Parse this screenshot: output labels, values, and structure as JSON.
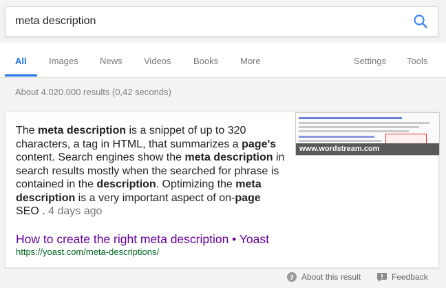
{
  "search": {
    "query": "meta description"
  },
  "tabs": [
    {
      "label": "All"
    },
    {
      "label": "Images"
    },
    {
      "label": "News"
    },
    {
      "label": "Videos"
    },
    {
      "label": "Books"
    },
    {
      "label": "More"
    }
  ],
  "tools": {
    "settings": "Settings",
    "tools": "Tools"
  },
  "stats": "About 4.020.000 results (0,42 seconds)",
  "snippet": {
    "parts": [
      "The ",
      "meta description",
      " is a snippet of up to 320 characters, a tag in HTML, that summarizes a ",
      "page's",
      " content. Search engines show the ",
      "meta description",
      " in search results mostly when the searched for phrase is contained in the ",
      "description",
      ". Optimizing the ",
      "meta description",
      " is a very important aspect of on-",
      "page",
      " SEO . "
    ],
    "date": "4 days ago",
    "thumbnail_caption": "www.wordstream.com"
  },
  "result": {
    "title": "How to create the right meta description • Yoast",
    "url": "https://yoast.com/meta-descriptions/"
  },
  "footer": {
    "about": "About this result",
    "feedback": "Feedback"
  },
  "colors": {
    "accent": "#1a73e8",
    "visited_link": "#660099",
    "url_green": "#006621"
  }
}
